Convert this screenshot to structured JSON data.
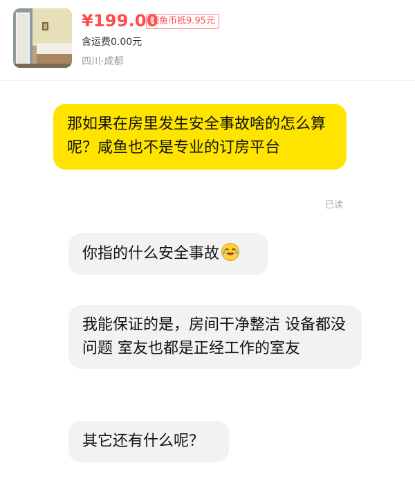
{
  "product": {
    "price": "¥199.00",
    "coin_discount": "闲鱼币抵9.95元",
    "shipping": "含运费0.00元",
    "location": "四川·成都",
    "image_alt": "room-photo"
  },
  "messages": [
    {
      "sender": "me",
      "text": "那如果在房里发生安全事故啥的怎么算呢？咸鱼也不是专业的订房平台",
      "status": "已读"
    },
    {
      "sender": "other",
      "text": "你指的什么安全事故",
      "emoji": "laughing-tears-emoji"
    },
    {
      "sender": "other",
      "text": "我能保证的是，房间干净整洁 设备都没问题  室友也都是正经工作的室友"
    },
    {
      "sender": "other",
      "text": "其它还有什么呢？"
    }
  ],
  "colors": {
    "price": "#ff4d4f",
    "my_bubble": "#ffe400",
    "other_bubble": "#f2f2f2",
    "read_status": "#a7a7a7"
  }
}
